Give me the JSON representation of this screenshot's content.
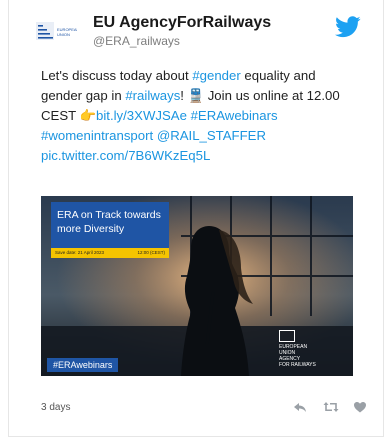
{
  "account": {
    "name": "EU AgencyForRailways",
    "handle": "@ERA_railways"
  },
  "tweet": {
    "lines": [
      [
        {
          "t": "Let's discuss today about ",
          "link": false
        },
        {
          "t": "#gender",
          "link": true
        },
        {
          "t": " equality and",
          "link": false
        }
      ],
      [
        {
          "t": "gender gap in ",
          "link": false
        },
        {
          "t": "#railways",
          "link": true
        },
        {
          "t": "! 🚆 Join us online at 12.00",
          "link": false
        }
      ],
      [
        {
          "t": "CEST ",
          "link": false
        },
        {
          "t": "👉",
          "link": false
        },
        {
          "t": "bit.ly/3XWJSAe",
          "link": true
        },
        {
          "t": " ",
          "link": false
        },
        {
          "t": "#ERAwebinars",
          "link": true
        }
      ],
      [
        {
          "t": "#womenintransport",
          "link": true
        },
        {
          "t": " ",
          "link": false
        },
        {
          "t": "@RAIL_STAFFER",
          "link": true
        }
      ],
      [
        {
          "t": "pic.twitter.com/7B6WKzEq5L",
          "link": true
        }
      ]
    ]
  },
  "media": {
    "title": "ERA on Track towards more Diversity",
    "date_label": "Save date: 21 April 2023",
    "time_label": "12:00 (CEST)",
    "hashtag": "#ERAwebinars",
    "logo_text": [
      "EUROPEAN",
      "UNION",
      "AGENCY",
      "FOR RAILWAYS"
    ]
  },
  "footer": {
    "time": "3 days"
  },
  "colors": {
    "link": "#1b95e0",
    "twitter_blue": "#1da1f2",
    "era_blue": "#1f55a5",
    "era_yellow": "#f5c400",
    "action_gray": "#9aa0a6"
  }
}
